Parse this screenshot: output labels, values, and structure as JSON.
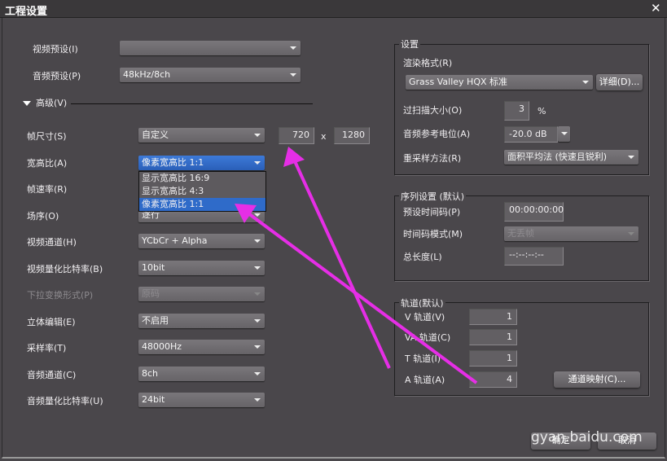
{
  "window": {
    "title": "工程设置",
    "close": "✕"
  },
  "left": {
    "video_preset": {
      "label": "视频预设(I)",
      "value": ""
    },
    "audio_preset": {
      "label": "音频预设(P)",
      "value": "48kHz/8ch"
    },
    "advanced": "高级(V)",
    "frame_size": {
      "label": "帧尺寸(S)",
      "value": "自定义",
      "width": "720",
      "x": "x",
      "height": "1280"
    },
    "aspect": {
      "label": "宽高比(A)",
      "value": "像素宽高比 1:1",
      "options": [
        "显示宽高比 16:9",
        "显示宽高比 4:3",
        "像素宽高比 1:1"
      ]
    },
    "frame_rate": {
      "label": "帧速率(R)"
    },
    "field_order": {
      "label": "场序(O)",
      "value": "逐行"
    },
    "video_channel": {
      "label": "视频通道(H)",
      "value": "YCbCr + Alpha"
    },
    "video_bits": {
      "label": "视频量化比特率(B)",
      "value": "10bit"
    },
    "pulldown": {
      "label": "下拉变换形式(P)",
      "value": "原码"
    },
    "stereo": {
      "label": "立体编辑(E)",
      "value": "不启用"
    },
    "sample_rate": {
      "label": "采样率(T)",
      "value": "48000Hz"
    },
    "audio_channel": {
      "label": "音频通道(C)",
      "value": "8ch"
    },
    "audio_bits": {
      "label": "音频量化比特率(U)",
      "value": "24bit"
    }
  },
  "settings": {
    "title": "设置",
    "render_format": {
      "label": "渲染格式(R)",
      "value": "Grass Valley HQX 标准",
      "detail": "详细(D)..."
    },
    "overscan": {
      "label": "过扫描大小(O)",
      "value": "3",
      "unit": "%"
    },
    "audio_ref": {
      "label": "音频参考电位(A)",
      "value": "-20.0 dB"
    },
    "resample": {
      "label": "重采样方法(R)",
      "value": "面积平均法 (快速且锐利)"
    }
  },
  "sequence": {
    "title": "序列设置 (默认)",
    "timecode": {
      "label": "预设时间码(P)",
      "value": "00:00:00:00"
    },
    "tc_mode": {
      "label": "时间码模式(M)",
      "value": "无丢帧"
    },
    "length": {
      "label": "总长度(L)",
      "value": "--:--:--:--"
    }
  },
  "tracks": {
    "title": "轨道(默认)",
    "v": {
      "label": "V 轨道(V)",
      "value": "1"
    },
    "va": {
      "label": "VA 轨道(C)",
      "value": "1"
    },
    "t": {
      "label": "T 轨道(I)",
      "value": "1"
    },
    "a": {
      "label": "A 轨道(A)",
      "value": "4"
    },
    "mapping": "通道映射(C)..."
  },
  "footer": {
    "ok": "确定",
    "cancel": "取消",
    "watermark": "gyan.baidu.com"
  },
  "colors": {
    "arrow": "#e62ee6",
    "selection": "#2f6bc9"
  }
}
